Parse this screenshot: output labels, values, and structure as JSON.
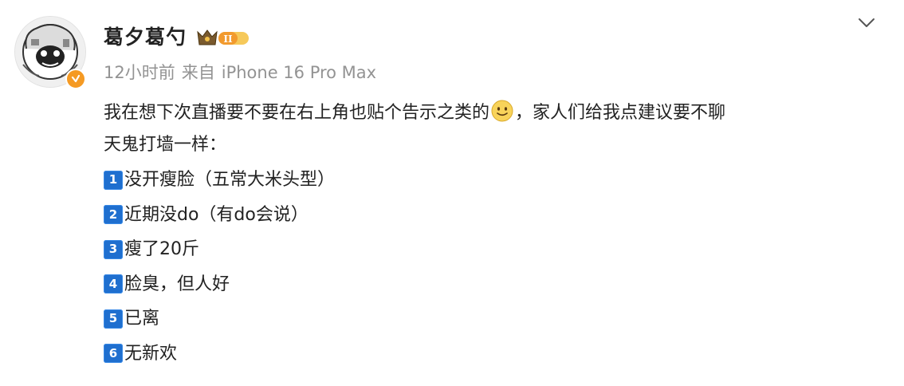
{
  "post": {
    "user": {
      "name": "葛夕葛勺",
      "vip_level": "II"
    },
    "meta": {
      "time": "12小时前",
      "source_prefix": "来自",
      "device": "iPhone 16 Pro Max"
    },
    "icons": {
      "avatar": "cartoon-avatar",
      "verified": "verified-badge",
      "vip": "crown-badge",
      "menu": "chevron-down-icon",
      "emoji": "smile-emoji"
    },
    "colors": {
      "keycap": "#1f6fcf",
      "verified": "#f59a23",
      "meta_text": "#939393"
    },
    "body": {
      "line1_before_emoji": "我在想下次直播要不要在右上角也贴个告示之类的",
      "line1_after_emoji": "，家人们给我点建议要不聊",
      "line2": "天鬼打墙一样："
    },
    "list": [
      {
        "num": "1",
        "text": "没开瘦脸（五常大米头型）"
      },
      {
        "num": "2",
        "text": "近期没do（有do会说）"
      },
      {
        "num": "3",
        "text": "瘦了20斤"
      },
      {
        "num": "4",
        "text": "脸臭，但人好"
      },
      {
        "num": "5",
        "text": "已离"
      },
      {
        "num": "6",
        "text": "无新欢"
      }
    ]
  }
}
